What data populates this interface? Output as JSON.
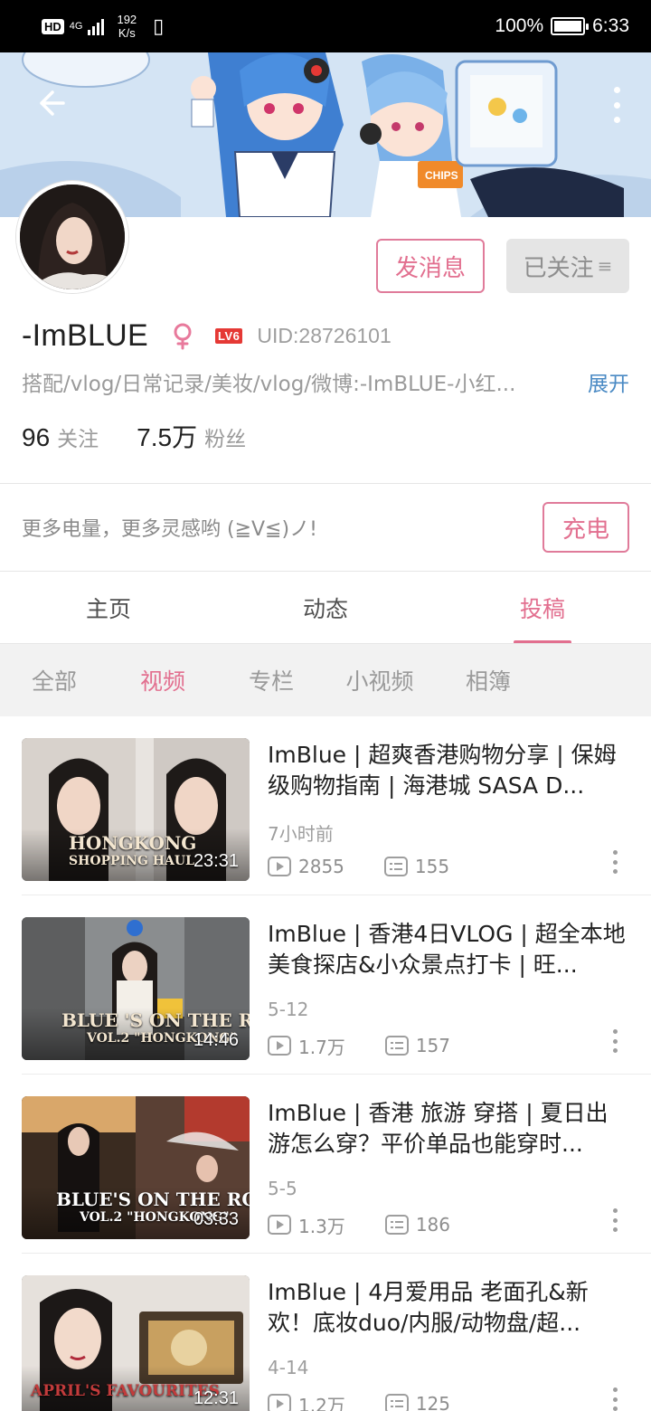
{
  "status_bar": {
    "hd": "HD",
    "net": "4G",
    "speed_value": "192",
    "speed_unit": "K/s",
    "battery": "100%",
    "time": "6:33"
  },
  "header": {
    "back_icon": "back-arrow-icon",
    "more_icon": "more-vertical-icon"
  },
  "profile": {
    "username": "-ImBLUE",
    "level": "LV6",
    "uid": "UID:28726101",
    "bio": "搭配/vlog/日常记录/美妆/vlog/微博:-ImBLUE-小红...",
    "expand_label": "展开",
    "following_count": "96",
    "following_label": "关注",
    "followers_count": "7.5万",
    "followers_label": "粉丝",
    "message_button": "发消息",
    "followed_button": "已关注",
    "followed_icon": "≡"
  },
  "charge": {
    "text": "更多电量，更多灵感哟 (≧V≦)ノ!",
    "button": "充电"
  },
  "tabs": [
    {
      "label": "主页",
      "active": false
    },
    {
      "label": "动态",
      "active": false
    },
    {
      "label": "投稿",
      "active": true
    }
  ],
  "subtabs": [
    {
      "label": "全部",
      "active": false
    },
    {
      "label": "视频",
      "active": true
    },
    {
      "label": "专栏",
      "active": false
    },
    {
      "label": "小视频",
      "active": false
    },
    {
      "label": "相簿",
      "active": false
    }
  ],
  "videos": [
    {
      "title": "ImBlue | 超爽香港购物分享 | 保姆级购物指南 | 海港城 SASA D...",
      "time": "7小时前",
      "plays": "2855",
      "danmaku": "155",
      "duration": "23:31",
      "thumb_text": "HONGKONG",
      "thumb_sub": "SHOPPING HAUL"
    },
    {
      "title": "ImBlue | 香港4日VLOG | 超全本地美食探店&小众景点打卡 | 旺...",
      "time": "5-12",
      "plays": "1.7万",
      "danmaku": "157",
      "duration": "14:46",
      "thumb_text": "BLUE 'S ON THE ROAD",
      "thumb_sub": "VOL.2 \"HONGKONG\""
    },
    {
      "title": "ImBlue | 香港 旅游 穿搭 | 夏日出游怎么穿？平价单品也能穿时...",
      "time": "5-5",
      "plays": "1.3万",
      "danmaku": "186",
      "duration": "03:33",
      "thumb_text": "BLUE'S ON THE ROAD",
      "thumb_sub": "VOL.2 \"HONGKONG\""
    },
    {
      "title": "ImBlue | 4月爱用品 老面孔&新欢！底妆duo/内服/动物盘/超...",
      "time": "4-14",
      "plays": "1.2万",
      "danmaku": "125",
      "duration": "12:31",
      "thumb_text": "APRIL'S FAVOURITES",
      "thumb_sub": ""
    }
  ],
  "colors": {
    "accent": "#e26f8f",
    "link": "#4a8ac4",
    "level_badge": "#e53935"
  }
}
